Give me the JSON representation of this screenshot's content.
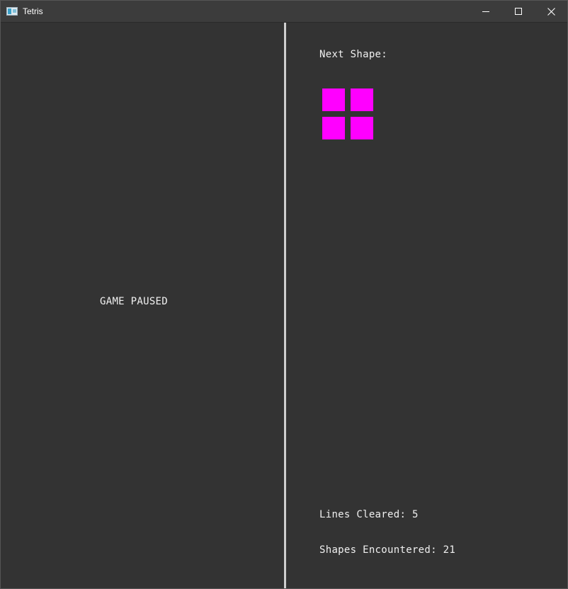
{
  "window": {
    "title": "Tetris",
    "icon": "tetris-app-icon",
    "controls": [
      "minimize-icon",
      "maximize-icon",
      "close-icon"
    ]
  },
  "game": {
    "status_text": "GAME PAUSED"
  },
  "panel": {
    "next_shape_label": "Next Shape:",
    "next_shape": {
      "name": "O",
      "color": "#ff00ff",
      "cells": [
        [
          0,
          0
        ],
        [
          1,
          0
        ],
        [
          0,
          1
        ],
        [
          1,
          1
        ]
      ]
    },
    "lines_cleared_label": "Lines Cleared:",
    "lines_cleared": "5",
    "shapes_encountered_label": "Shapes Encountered:",
    "shapes_encountered": "21"
  },
  "colors": {
    "background": "#333333",
    "divider": "#cfcfcf",
    "text": "#f0f0f0",
    "titlebar": "#3c3c3c"
  }
}
